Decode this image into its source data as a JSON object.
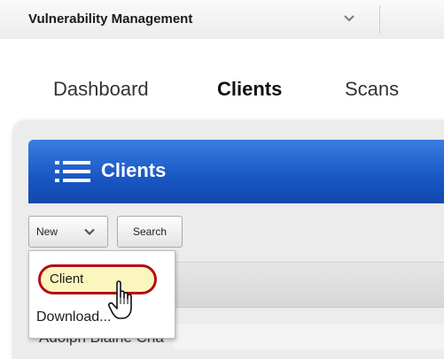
{
  "app": {
    "title": "Vulnerability Management"
  },
  "nav": {
    "tabs": [
      {
        "label": "Dashboard"
      },
      {
        "label": "Clients"
      },
      {
        "label": "Scans"
      }
    ]
  },
  "panel": {
    "title": "Clients"
  },
  "toolbar": {
    "new_label": "New",
    "search_label": "Search"
  },
  "dropdown": {
    "items": [
      {
        "label": "Client"
      },
      {
        "label": "Download..."
      }
    ]
  },
  "table": {
    "first_row_partial": "Adolph Blaine Cha"
  },
  "colors": {
    "header_blue": "#1857c4",
    "highlight_fill": "#fbf6be",
    "highlight_border": "#b30f15"
  }
}
